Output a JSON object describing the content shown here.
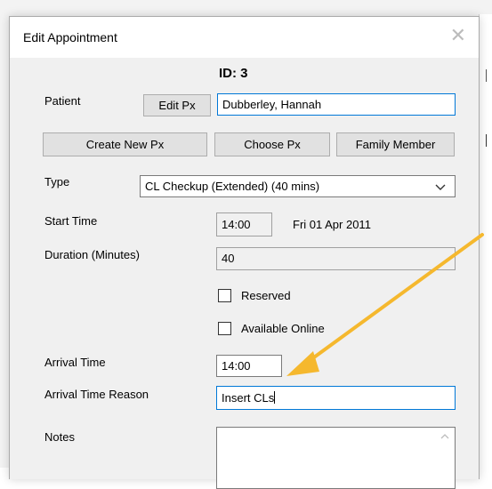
{
  "dialog": {
    "title": "Edit Appointment",
    "close_icon": "close-icon"
  },
  "id_label": "ID: 3",
  "patient": {
    "label": "Patient",
    "edit_button": "Edit Px",
    "value": "Dubberley, Hannah"
  },
  "buttons": {
    "create_new": "Create New Px",
    "choose": "Choose Px",
    "family": "Family Member"
  },
  "type": {
    "label": "Type",
    "value": "CL Checkup (Extended) (40 mins)"
  },
  "start_time": {
    "label": "Start Time",
    "time": "14:00",
    "date": "Fri 01 Apr 2011"
  },
  "duration": {
    "label": "Duration (Minutes)",
    "value": "40"
  },
  "checkboxes": {
    "reserved": {
      "label": "Reserved",
      "checked": false
    },
    "available_online": {
      "label": "Available Online",
      "checked": false
    }
  },
  "arrival_time": {
    "label": "Arrival Time",
    "value": "14:00"
  },
  "arrival_reason": {
    "label": "Arrival Time Reason",
    "value": "Insert CLs"
  },
  "notes": {
    "label": "Notes",
    "value": ""
  },
  "colors": {
    "annotation_arrow": "#f5b82e",
    "focus_border": "#0078d7"
  }
}
